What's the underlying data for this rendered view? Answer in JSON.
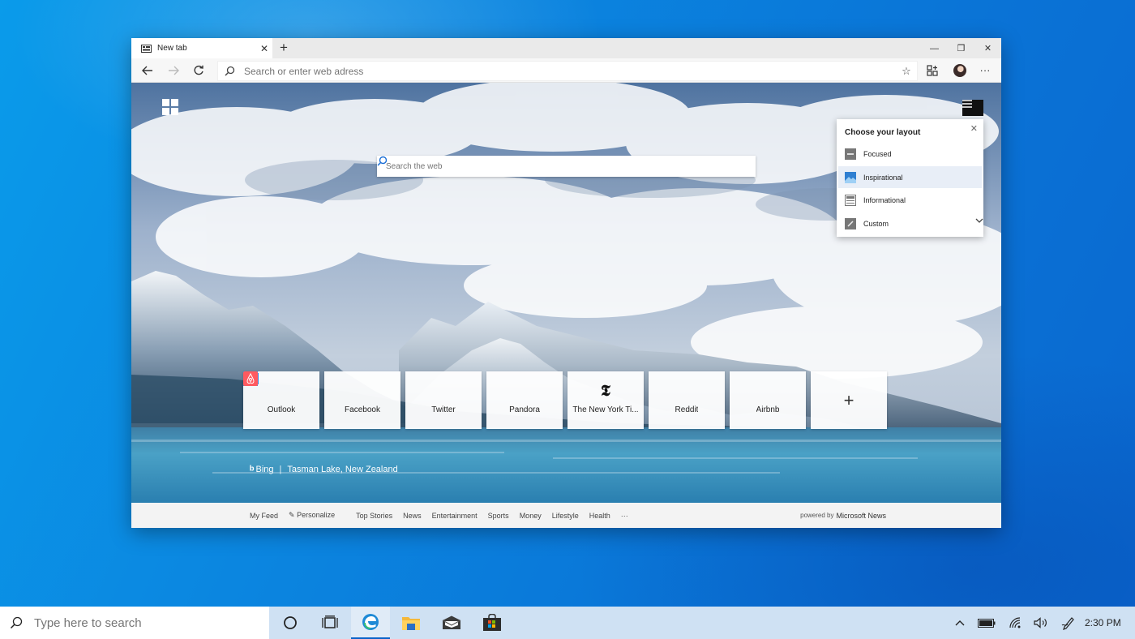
{
  "browser": {
    "tab": {
      "title": "New tab",
      "close": "✕"
    },
    "new_tab": "+",
    "controls": {
      "minimize": "—",
      "maximize": "❐",
      "close": "✕"
    },
    "address": {
      "placeholder": "Search or enter web adress"
    },
    "more": "···"
  },
  "newtab": {
    "search_placeholder": "Search the web",
    "layout_panel": {
      "title": "Choose your layout",
      "close": "✕",
      "options": [
        {
          "label": "Focused",
          "icon": "focused-layout-icon"
        },
        {
          "label": "Inspirational",
          "icon": "inspirational-layout-icon",
          "selected": true
        },
        {
          "label": "Informational",
          "icon": "informational-layout-icon"
        },
        {
          "label": "Custom",
          "icon": "custom-layout-icon"
        }
      ]
    },
    "tiles": [
      {
        "label": "Outlook",
        "icon": "outlook-icon",
        "color": "#0a64c8"
      },
      {
        "label": "Facebook",
        "icon": "facebook-icon",
        "color": "#3b5998"
      },
      {
        "label": "Twitter",
        "icon": "twitter-icon",
        "color": "#1da1f2"
      },
      {
        "label": "Pandora",
        "icon": "pandora-icon",
        "color": "#2a8ff0"
      },
      {
        "label": "The New York Ti...",
        "icon": "nyt-icon",
        "color": "#111111"
      },
      {
        "label": "Reddit",
        "icon": "reddit-icon",
        "color": "#ff4500"
      },
      {
        "label": "Airbnb",
        "icon": "airbnb-icon",
        "color": "#ff5a60"
      }
    ],
    "add_tile": "+",
    "image_credit": {
      "brand": "Bing",
      "separator": "|",
      "location": "Tasman Lake, New Zealand"
    },
    "feed": {
      "links": [
        "My Feed",
        "Personalize",
        "Top Stories",
        "News",
        "Entertainment",
        "Sports",
        "Money",
        "Lifestyle",
        "Health",
        "···"
      ],
      "powered_by": "powered by",
      "provider": "Microsoft News"
    }
  },
  "taskbar": {
    "search_placeholder": "Type here to search",
    "clock": "2:30 PM"
  },
  "colors": {
    "taskbar": "#cfe1f3",
    "desktop": "#0b86e0",
    "accent": "#0a63c9"
  }
}
